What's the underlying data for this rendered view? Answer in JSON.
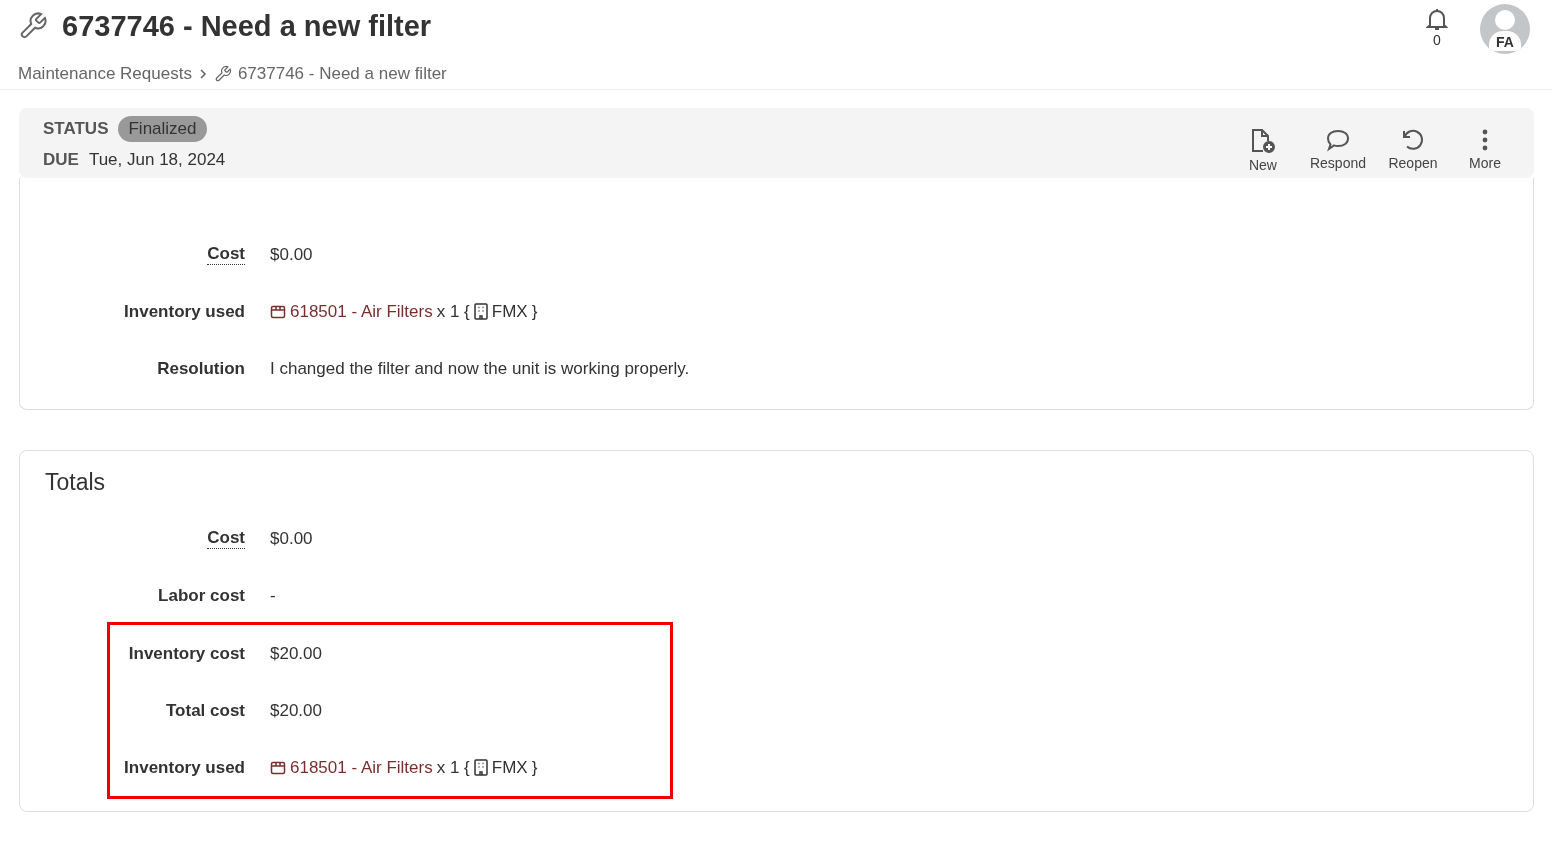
{
  "header": {
    "title": "6737746 - Need a new filter",
    "notifications": "0",
    "avatar": "FA"
  },
  "breadcrumb": {
    "parent": "Maintenance Requests",
    "current": "6737746 - Need a new filter"
  },
  "status_bar": {
    "status_label": "STATUS",
    "status": "Finalized",
    "due_label": "DUE",
    "due": "Tue, Jun 18, 2024",
    "actions": [
      {
        "kind": "new",
        "label": "New"
      },
      {
        "kind": "respond",
        "label": "Respond"
      },
      {
        "kind": "reopen",
        "label": "Reopen"
      },
      {
        "kind": "more",
        "label": "More"
      }
    ]
  },
  "details": {
    "rows": [
      {
        "kind": "text",
        "label": "Cost",
        "dotted": true,
        "value": "$0.00",
        "highlighted": false
      },
      {
        "kind": "inventory",
        "label": "Inventory used",
        "dotted": false,
        "item": "618501 - Air Filters",
        "quantity": "x 1 {",
        "location": "FMX",
        "close": "}",
        "highlighted": false
      },
      {
        "kind": "text",
        "label": "Resolution",
        "dotted": false,
        "value": "I changed the filter and now the unit is working properly.",
        "highlighted": false
      }
    ]
  },
  "totals": {
    "title": "Totals",
    "rows": [
      {
        "kind": "text",
        "label": "Cost",
        "dotted": true,
        "value": "$0.00",
        "highlighted": false
      },
      {
        "kind": "text",
        "label": "Labor cost",
        "dotted": false,
        "value": "-",
        "highlighted": false
      },
      {
        "kind": "text",
        "label": "Inventory cost",
        "dotted": false,
        "value": "$20.00",
        "highlighted": true
      },
      {
        "kind": "text",
        "label": "Total cost",
        "dotted": false,
        "value": "$20.00",
        "highlighted": true
      },
      {
        "kind": "inventory",
        "label": "Inventory used",
        "dotted": false,
        "item": "618501 - Air Filters",
        "quantity": "x 1 {",
        "location": "FMX",
        "close": "}",
        "highlighted": true
      }
    ]
  }
}
